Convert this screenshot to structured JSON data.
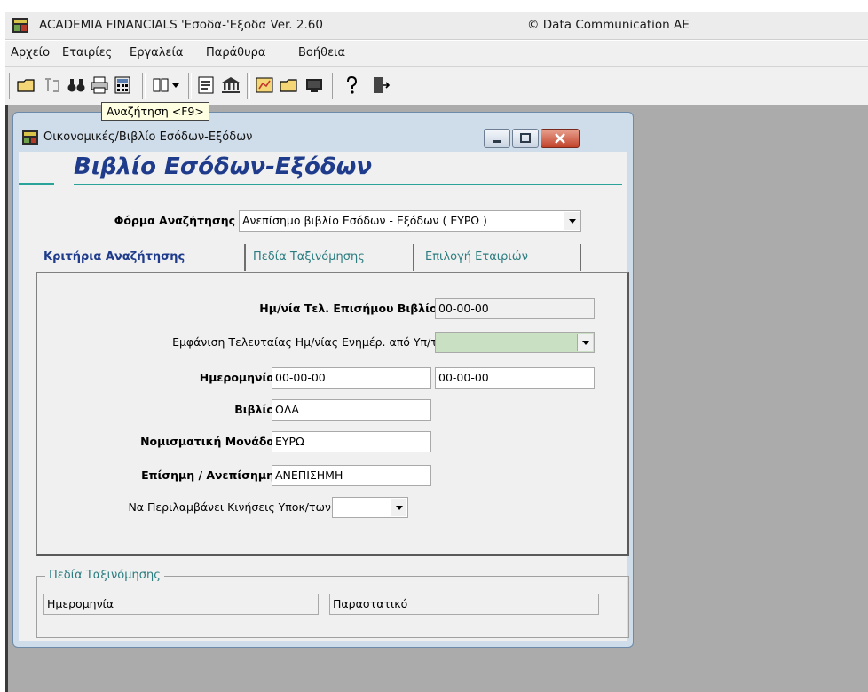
{
  "app": {
    "title": "ACADEMIA FINANCIALS 'Εσοδα-'Εξοδα Ver. 2.60",
    "copyright": "© Data Communication AE"
  },
  "menu": {
    "items": [
      "Αρχείο",
      "Εταιρίες",
      "Εργαλεία",
      "Παράθυρα",
      "Βοήθεια"
    ]
  },
  "toolbar": {
    "tooltip": "Αναζήτηση <F9>"
  },
  "window": {
    "title": "Οικονομικές/Βιβλίο Εσόδων-Εξόδων",
    "heading": "Βιβλίο Εσόδων-Εξόδων"
  },
  "form": {
    "search_form_label": "Φόρμα Αναζήτησης",
    "search_form_value": "Ανεπίσημο βιβλίο Εσόδων - Εξόδων ( ΕΥΡΩ )"
  },
  "tabs": [
    "Κριτήρια Αναζήτησης",
    "Πεδία Ταξινόμησης",
    "Επιλογή Εταιριών"
  ],
  "criteria": {
    "official_date_label": "Ημ/νία Τελ. Επισήμου Βιβλίου",
    "official_date_value": "00-00-00",
    "show_last_date_label": "Εμφάνιση Τελευταίας Ημ/νίας Ενημέρ. από Υπ/τα",
    "show_last_date_value": "",
    "date_label": "Ημερομηνία",
    "date_from": "00-00-00",
    "date_to": "00-00-00",
    "book_label": "Βιβλίο",
    "book_value": "ΟΛΑ",
    "currency_label": "Νομισματική Μονάδα",
    "currency_value": "ΕΥΡΩ",
    "official_label": "Επίσημη / Ανεπίσημη",
    "official_value": "ΑΝΕΠΙΣΗΜΗ",
    "include_sub_label": "Να Περιλαμβάνει Κινήσεις Υποκ/των",
    "include_sub_value": ""
  },
  "sort_fields": {
    "legend": "Πεδία Ταξινόμησης",
    "field1": "Ημερομηνία",
    "field2": "Παραστατικό"
  },
  "colors": {
    "heading": "#1f3c8c",
    "accent_line": "#2aa39a",
    "inactive_tab": "#2c7d80",
    "green_field": "#c9e0c2",
    "workspace": "#ababab"
  }
}
